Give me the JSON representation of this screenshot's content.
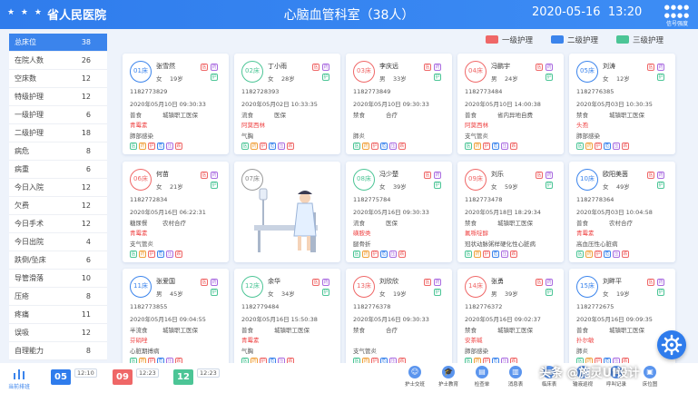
{
  "header": {
    "hospital": "省人民医院",
    "department": "心脑血管科室（38人）",
    "date": "2020-05-16",
    "time": "13:20",
    "settings_label": "信号强度"
  },
  "legend": [
    {
      "label": "一级护理",
      "color": "#ef6767"
    },
    {
      "label": "二级护理",
      "color": "#3b84ec"
    },
    {
      "label": "三级护理",
      "color": "#4cc596"
    }
  ],
  "sidebar": [
    {
      "label": "总床位",
      "count": "38"
    },
    {
      "label": "在院人数",
      "count": "26"
    },
    {
      "label": "空床数",
      "count": "12"
    },
    {
      "label": "特级护理",
      "count": "12"
    },
    {
      "label": "一级护理",
      "count": "6"
    },
    {
      "label": "二级护理",
      "count": "18"
    },
    {
      "label": "病危",
      "count": "8"
    },
    {
      "label": "病重",
      "count": "6"
    },
    {
      "label": "今日入院",
      "count": "12"
    },
    {
      "label": "欠费",
      "count": "12"
    },
    {
      "label": "今日手术",
      "count": "12"
    },
    {
      "label": "今日出院",
      "count": "4"
    },
    {
      "label": "跌倒/坠床",
      "count": "6"
    },
    {
      "label": "导管滑落",
      "count": "10"
    },
    {
      "label": "压疮",
      "count": "8"
    },
    {
      "label": "疼痛",
      "count": "11"
    },
    {
      "label": "误吸",
      "count": "12"
    },
    {
      "label": "自理能力",
      "count": "8"
    }
  ],
  "cards": [
    {
      "bed": "01床",
      "level": "b",
      "name": "张雪然",
      "sex": "女",
      "age": "19岁",
      "id": "1182773829",
      "admit": "2020年05月10日  09:30:33",
      "diet": "普食",
      "ins": "城镇职工医保",
      "allergy": "青霉素",
      "diag": "肺部感染"
    },
    {
      "bed": "02床",
      "level": "g",
      "name": "丁小雨",
      "sex": "女",
      "age": "28岁",
      "id": "1182728393",
      "admit": "2020年05月02日  10:33:35",
      "diet": "流食",
      "ins": "医保",
      "allergy": "阿莫西林",
      "diag": "气胸"
    },
    {
      "bed": "03床",
      "level": "r",
      "name": "李庆远",
      "sex": "男",
      "age": "33岁",
      "id": "1182773849",
      "admit": "2020年05月10日  09:30:33",
      "diet": "禁食",
      "ins": "合疗",
      "allergy": "",
      "diag": "肺炎"
    },
    {
      "bed": "04床",
      "level": "r",
      "name": "冯鹏宇",
      "sex": "男",
      "age": "24岁",
      "id": "1182773484",
      "admit": "2020年05月10日  14:00:38",
      "diet": "普食",
      "ins": "省内异地自费",
      "allergy": "阿莫西林",
      "diag": "支气管炎"
    },
    {
      "bed": "05床",
      "level": "b",
      "name": "刘涛",
      "sex": "女",
      "age": "12岁",
      "id": "1182776385",
      "admit": "2020年05月03日  10:30:35",
      "diet": "禁食",
      "ins": "城镇职工医保",
      "allergy": "头孢",
      "diag": "肺部感染"
    },
    {
      "bed": "06床",
      "level": "r",
      "name": "何苗",
      "sex": "女",
      "age": "21岁",
      "id": "1182772834",
      "admit": "2020年05月16日  06:22:31",
      "diet": "糖尿餐",
      "ins": "农村合疗",
      "allergy": "青霉素",
      "diag": "支气管炎"
    },
    {
      "bed": "07床",
      "level": "empty"
    },
    {
      "bed": "08床",
      "level": "g",
      "name": "冯少楚",
      "sex": "女",
      "age": "39岁",
      "id": "1182775784",
      "admit": "2020年05月16日  09:30:33",
      "diet": "流食",
      "ins": "医保",
      "allergy": "磺胺类",
      "diag": "腿骨折"
    },
    {
      "bed": "09床",
      "level": "r",
      "name": "刘乐",
      "sex": "女",
      "age": "59岁",
      "id": "1182773478",
      "admit": "2020年05月18日  18:29:34",
      "diet": "禁食",
      "ins": "城镇职工医保",
      "allergy": "氟哌啶醇",
      "diag": "冠状动脉粥样硬化性心脏病"
    },
    {
      "bed": "10床",
      "level": "b",
      "name": "欧阳美茵",
      "sex": "女",
      "age": "49岁",
      "id": "1182778364",
      "admit": "2020年05月03日  10:04:58",
      "diet": "普食",
      "ins": "农村合疗",
      "allergy": "青霉素",
      "diag": "高血压性心脏病"
    },
    {
      "bed": "11床",
      "level": "b",
      "name": "张爱国",
      "sex": "男",
      "age": "45岁",
      "id": "1182773855",
      "admit": "2020年05月16日  09:04:55",
      "diet": "半流食",
      "ins": "城镇职工医保",
      "allergy": "芬硝唑",
      "diag": "心脏期搏病"
    },
    {
      "bed": "12床",
      "level": "g",
      "name": "余华",
      "sex": "女",
      "age": "34岁",
      "id": "1182779484",
      "admit": "2020年05月16日  15:50:38",
      "diet": "普食",
      "ins": "城镇职工医保",
      "allergy": "青霉素",
      "diag": "气胸"
    },
    {
      "bed": "13床",
      "level": "r",
      "name": "刘欣欣",
      "sex": "女",
      "age": "19岁",
      "id": "1182776378",
      "admit": "2020年05月16日  09:30:33",
      "diet": "禁食",
      "ins": "合疗",
      "allergy": "",
      "diag": "支气管炎"
    },
    {
      "bed": "14床",
      "level": "r",
      "name": "张勇",
      "sex": "男",
      "age": "39岁",
      "id": "1182776372",
      "admit": "2020年05月16日  09:02:37",
      "diet": "禁食",
      "ins": "城镇职工医保",
      "allergy": "安茶碱",
      "diag": "肺部感染"
    },
    {
      "bed": "15床",
      "level": "b",
      "name": "刘畔平",
      "sex": "女",
      "age": "19岁",
      "id": "1182772675",
      "admit": "2020年05月16日  09:09:35",
      "diet": "普食",
      "ins": "城镇职工医保",
      "allergy": "扑尔敏",
      "diag": "肺炎"
    }
  ],
  "bottom": {
    "current": "当前排班",
    "shifts": [
      {
        "num": "05",
        "time": "12:10",
        "color": "#2f7cec"
      },
      {
        "num": "09",
        "time": "12:23",
        "color": "#ef6767"
      },
      {
        "num": "12",
        "time": "12:23",
        "color": "#4cc596"
      }
    ],
    "buttons": [
      "护士交班",
      "护士教育",
      "检查单",
      "消息表",
      "临床表",
      "输液巡视",
      "呼叫记录",
      "床位图"
    ]
  },
  "watermark": "头条 @施灵UI设计"
}
